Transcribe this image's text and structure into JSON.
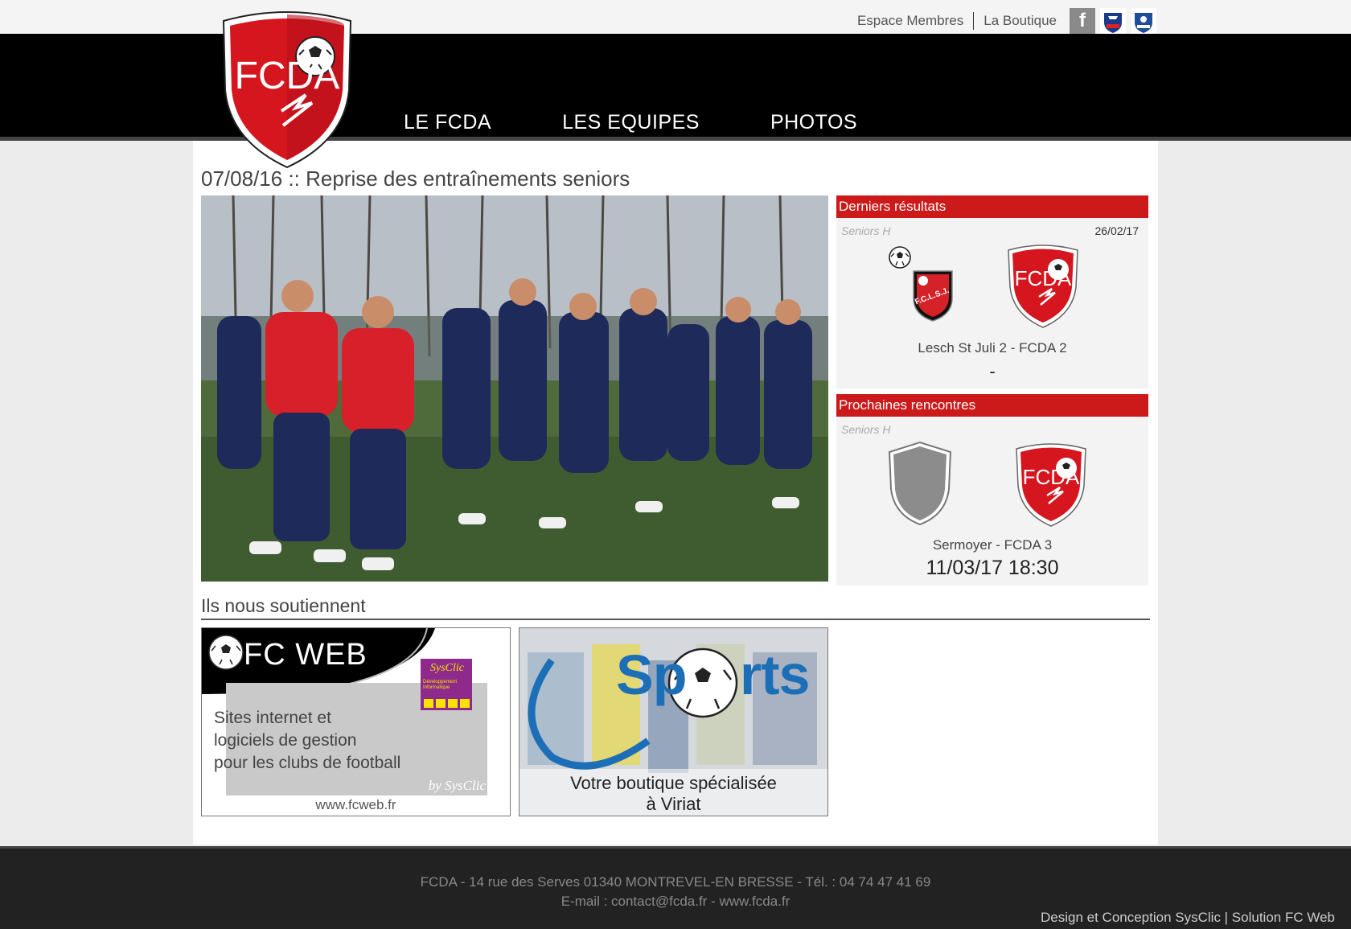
{
  "header": {
    "links": {
      "members": "Espace Membres",
      "shop": "La Boutique"
    },
    "social": {
      "facebook": "f"
    },
    "logo_text": "FCDA"
  },
  "nav": {
    "item1": "LE FCDA",
    "item2": "LES EQUIPES",
    "item3": "PHOTOS"
  },
  "article": {
    "title": "07/08/16 :: Reprise des entraînements seniors"
  },
  "results": {
    "heading": "Derniers résultats",
    "competition": "Seniors H",
    "date": "26/02/17",
    "match": "Lesch St Juli 2 - FCDA 2",
    "score": "-",
    "home_badge_text": "F.C.L.S.J."
  },
  "upcoming": {
    "heading": "Prochaines rencontres",
    "competition": "Seniors H",
    "match": "Sermoyer - FCDA 3",
    "datetime": "11/03/17 18:30"
  },
  "sponsors": {
    "heading": "Ils nous soutiennent",
    "fcweb": {
      "brand": "FC WEB",
      "badge": "SysClic",
      "badge_sub": "Développement Informatique",
      "line1": "Sites internet et",
      "line2": "logiciels de gestion",
      "line3": "pour les clubs de football",
      "by": "by SysClic",
      "url": "www.fcweb.fr"
    },
    "csports": {
      "brand_left": "Sp",
      "brand_right": "rts",
      "line1": "Votre boutique spécialisée",
      "line2": "à Viriat"
    }
  },
  "footer": {
    "address": "FCDA - 14 rue des Serves 01340 MONTREVEL-EN BRESSE - Tél. : 04 74 47 41 69",
    "email": "E-mail : contact@fcda.fr - www.fcda.fr",
    "credit": "Design et Conception SysClic | Solution FC Web"
  },
  "colors": {
    "accent": "#cc1a1a",
    "nav_bg": "#000000",
    "footer_bg": "#222222"
  }
}
